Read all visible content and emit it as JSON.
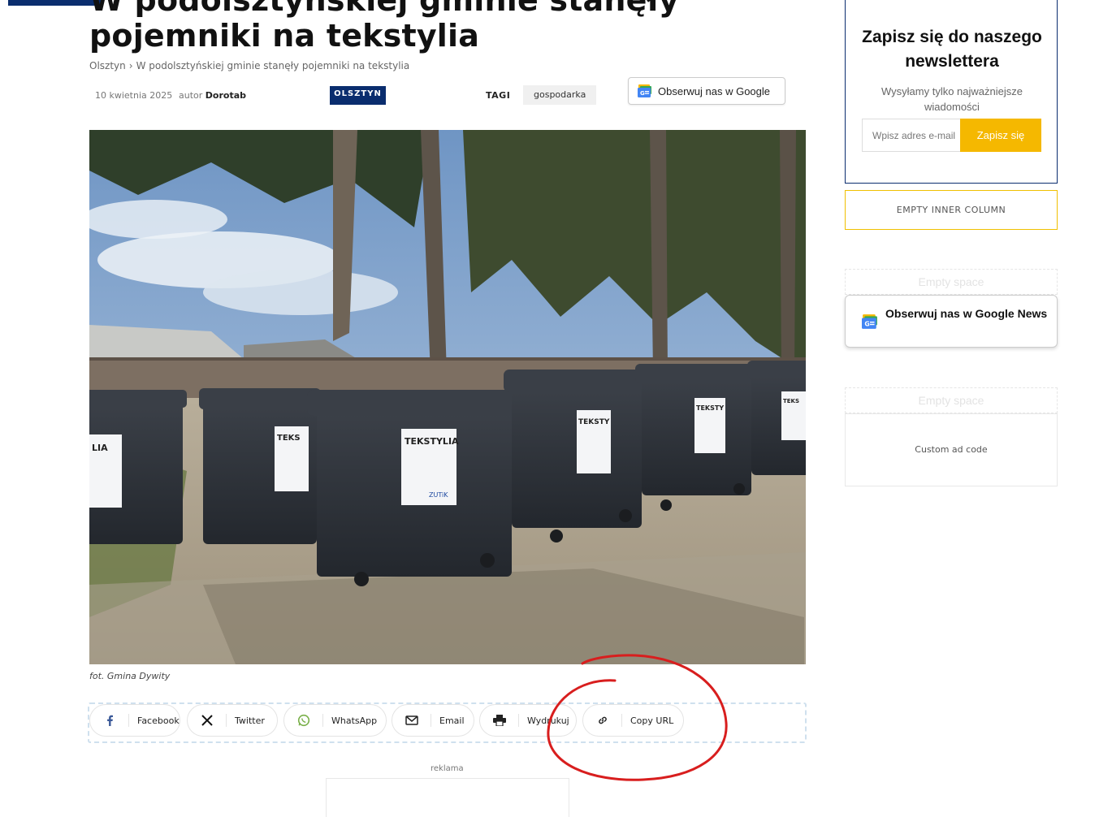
{
  "article": {
    "title_line1": "W podolsztyńskiej gminie stanęły",
    "title_line2": "pojemniki na tekstylia",
    "breadcrumb": {
      "home": "Olsztyn",
      "separator": "›",
      "current": "W podolsztyńskiej gminie stanęły pojemniki na tekstylia"
    },
    "date": "10 kwietnia 2025",
    "author_prefix": "autor",
    "author": "Dorotab",
    "category": "OLSZTYN",
    "tags_label": "TAGI",
    "tag": "gospodarka",
    "google_follow": "Obserwuj nas w Google",
    "caption": "fot. Gmina Dywity"
  },
  "share": {
    "facebook": "Facebook",
    "twitter": "Twitter",
    "whatsapp": "WhatsApp",
    "email": "Email",
    "print": "Wydrukuj",
    "copy_url": "Copy URL"
  },
  "ad": {
    "label": "reklama"
  },
  "sidebar": {
    "newsletter": {
      "title": "Zapisz się do naszego newslettera",
      "subtitle": "Wysyłamy tylko najważniejsze wiadomości",
      "placeholder": "Wpisz adres e-mail",
      "button": "Zapisz się"
    },
    "empty_inner": "EMPTY INNER COLUMN",
    "empty_space": "Empty space",
    "google_news": "Obserwuj nas w Google News",
    "custom_ad": "Custom ad code"
  },
  "photo": {
    "bin_label": "TEKSTYLIA",
    "bin_brand": "ZUTiK"
  },
  "colors": {
    "brand_navy": "#0a2d6e",
    "accent_yellow": "#f5b800",
    "annotation_red": "#d81e1e"
  }
}
